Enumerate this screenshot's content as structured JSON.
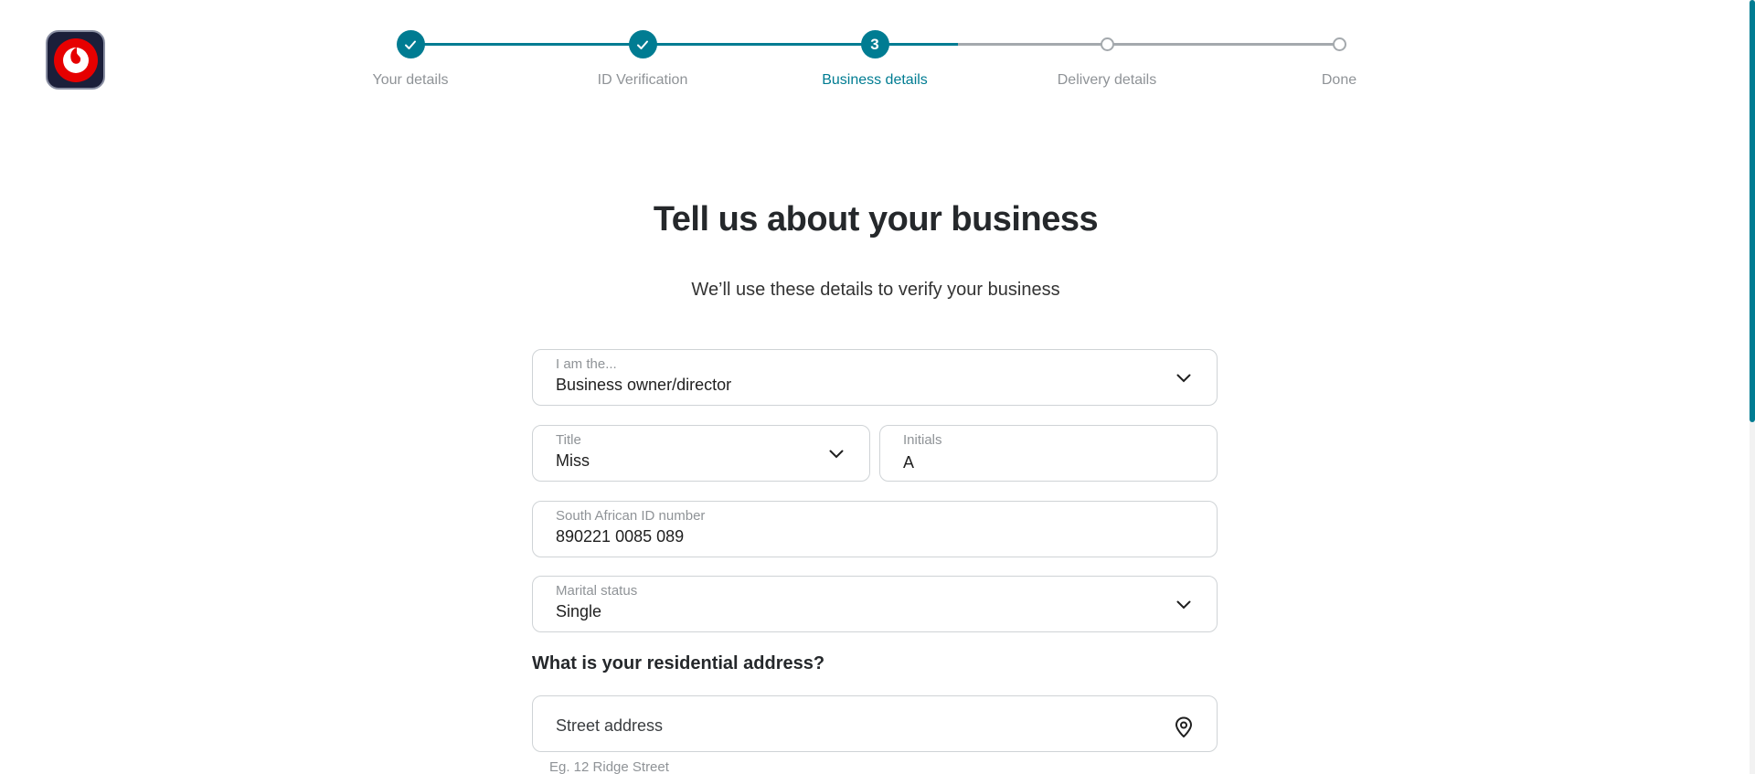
{
  "brand": {
    "logo_icon": "vodafone-logo-icon",
    "accent": "#007c92"
  },
  "stepper": {
    "steps": [
      {
        "label": "Your details",
        "state": "done"
      },
      {
        "label": "ID Verification",
        "state": "done"
      },
      {
        "label": "Business details",
        "state": "active",
        "number": "3"
      },
      {
        "label": "Delivery details",
        "state": "pending"
      },
      {
        "label": "Done",
        "state": "pending"
      }
    ]
  },
  "page": {
    "title": "Tell us about your business",
    "subtitle": "We’ll use these details to verify your business"
  },
  "form": {
    "role": {
      "label": "I am the...",
      "value": "Business owner/director"
    },
    "title_field": {
      "label": "Title",
      "value": "Miss"
    },
    "initials": {
      "label": "Initials",
      "value": "A"
    },
    "id_number": {
      "label": "South African ID number",
      "value": "890221 0085 089"
    },
    "marital_status": {
      "label": "Marital status",
      "value": "Single"
    },
    "address_section": "What is your residential address?",
    "street": {
      "placeholder": "Street address",
      "helper": "Eg. 12 Ridge Street"
    }
  }
}
